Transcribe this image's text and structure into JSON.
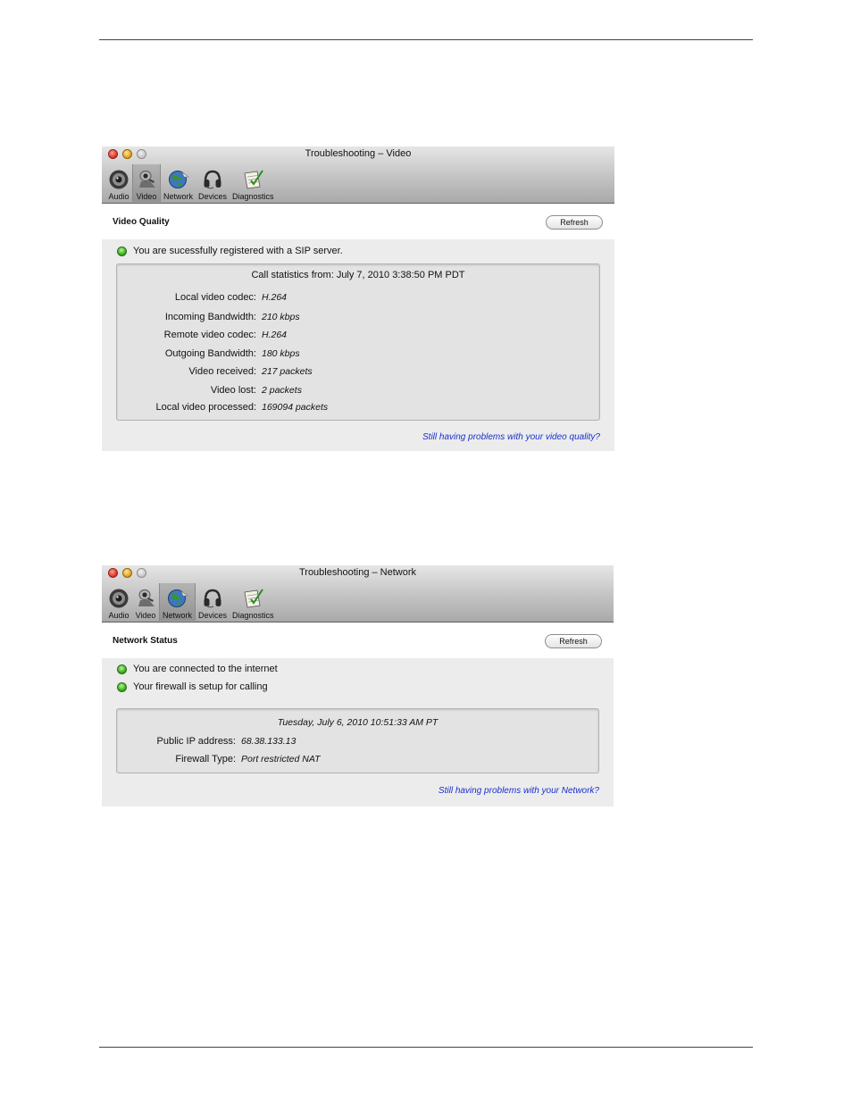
{
  "video_window": {
    "title": "Troubleshooting – Video",
    "toolbar": [
      {
        "label": "Audio",
        "icon": "speaker-icon"
      },
      {
        "label": "Video",
        "icon": "webcam-icon"
      },
      {
        "label": "Network",
        "icon": "globe-icon"
      },
      {
        "label": "Devices",
        "icon": "headset-icon"
      },
      {
        "label": "Diagnostics",
        "icon": "notepad-icon"
      }
    ],
    "active_tab": "Video",
    "section_title": "Video Quality",
    "refresh_label": "Refresh",
    "status_message": "You are sucessfully registered with a SIP server.",
    "stats_header": "Call statistics from: July 7, 2010 3:38:50 PM PDT",
    "stats": [
      {
        "label": "Local video codec:",
        "value": "H.264"
      },
      {
        "label": "Incoming Bandwidth:",
        "value": "210 kbps"
      },
      {
        "label": "Remote video codec:",
        "value": "H.264"
      },
      {
        "label": "Outgoing Bandwidth:",
        "value": "180 kbps"
      },
      {
        "label": "Video received:",
        "value": "217 packets"
      },
      {
        "label": "Video lost:",
        "value": "2 packets"
      },
      {
        "label": "Local video processed:",
        "value": "169094 packets"
      }
    ],
    "help_link": "Still having problems with your video quality?"
  },
  "network_window": {
    "title": "Troubleshooting – Network",
    "toolbar": [
      {
        "label": "Audio",
        "icon": "speaker-icon"
      },
      {
        "label": "Video",
        "icon": "webcam-icon"
      },
      {
        "label": "Network",
        "icon": "globe-icon"
      },
      {
        "label": "Devices",
        "icon": "headset-icon"
      },
      {
        "label": "Diagnostics",
        "icon": "notepad-icon"
      }
    ],
    "active_tab": "Network",
    "section_title": "Network Status",
    "refresh_label": "Refresh",
    "status_messages": [
      "You are connected to the internet",
      "Your firewall is setup for calling"
    ],
    "stats_header": "Tuesday, July 6, 2010 10:51:33 AM PT",
    "stats": [
      {
        "label": "Public IP address:",
        "value": "68.38.133.13"
      },
      {
        "label": "Firewall Type:",
        "value": "Port restricted NAT"
      }
    ],
    "help_link": "Still having problems with your Network?"
  },
  "colors": {
    "status_ok": "#3bb01c",
    "link": "#1a2fcc"
  }
}
